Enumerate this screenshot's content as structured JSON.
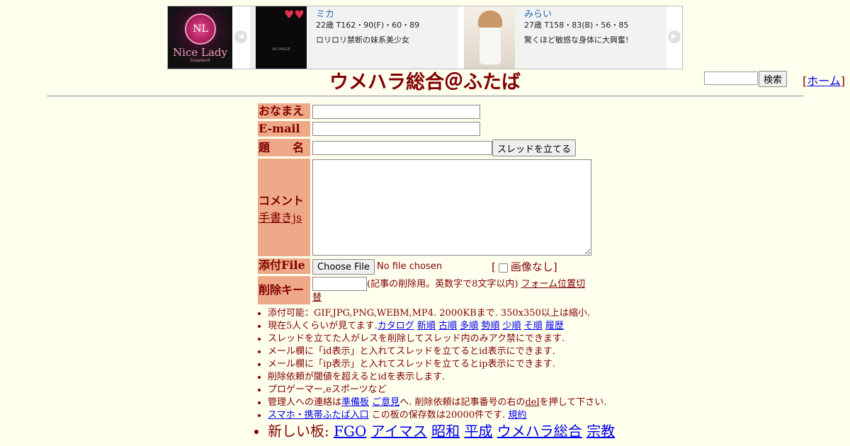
{
  "banner": {
    "logo_text": "Nice Lady",
    "logo_sub": "Soapland",
    "logo_mark": "NL",
    "cards": [
      {
        "name": "ミカ",
        "spec": "22歳 T162・90(F)・60・89",
        "desc": "ロリロリ禁断の妹系美少女",
        "photo_caption": "NO IMAGE"
      },
      {
        "name": "みらい",
        "spec": "27歳 T158・83(B)・56・85",
        "desc": "驚くほど敏感な身体に大興奮!"
      }
    ]
  },
  "header": {
    "title": "ウメハラ総合＠ふたば",
    "search_button": "検索",
    "home_link": "ホーム"
  },
  "form": {
    "name_label": "おなまえ",
    "email_label": "E-mail",
    "subject_label": "題　　名",
    "submit_button": "スレッドを立てる",
    "comment_label": "コメント",
    "handwrite_link": "手書きjs",
    "attach_label": "添付File",
    "choose_file": "Choose File",
    "no_file": "No file chosen",
    "no_image_label": "画像なし",
    "delete_key_label": "削除キー",
    "delete_key_note": "(記事の削除用。英数字で8文字以内)",
    "form_position_link": "フォーム位置切替"
  },
  "notes": {
    "n1": "添付可能：GIF,JPG,PNG,WEBM,MP4. 2000KBまで. 350x350以上は縮小.",
    "n2_prefix": "現在5人くらいが見てます.",
    "n2_links": [
      "カタログ",
      "新順",
      "古順",
      "多順",
      "勢順",
      "少順",
      "そ順",
      "履歴"
    ],
    "n3": "スレッドを立てた人がレスを削除してスレッド内のみアク禁にできます.",
    "n4": "メール欄に「id表示」と入れてスレッドを立てるとid表示にできます.",
    "n5": "メール欄に「ip表示」と入れてスレッドを立てるとip表示にできます.",
    "n6": "削除依頼が閾値を超えるとidを表示します.",
    "n7": "プロゲーマー,eスポーツなど",
    "n8_prefix": "管理人への連絡は",
    "n8_link1": "準備板",
    "n8_link2": "ご意見",
    "n8_mid": "へ. 削除依頼は記事番号の右の",
    "n8_del": "del",
    "n8_suffix": "を押して下さい.",
    "n9_link": "スマホ・携帯ふたば入口",
    "n9_mid": " この板の保存数は20000件です. ",
    "n9_rules": "規約",
    "n10_prefix": "新しい板: ",
    "n10_links": [
      "FGO",
      "アイマス",
      "昭和",
      "平成",
      "ウメハラ総合",
      "宗教"
    ]
  }
}
